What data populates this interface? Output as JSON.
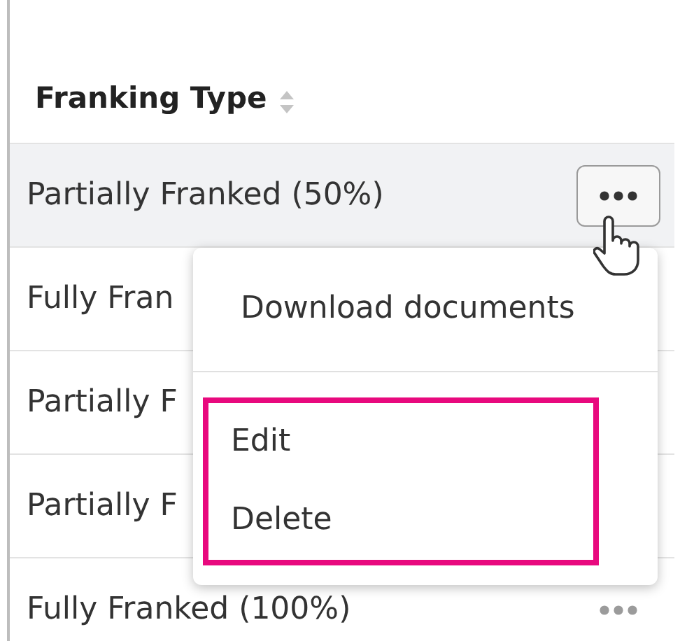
{
  "table": {
    "columns": [
      {
        "label": "Franking Type",
        "sortable": true
      }
    ],
    "rows": [
      {
        "cell": "Partially Franked (50%)",
        "selected": true
      },
      {
        "cell": "Fully Fran",
        "selected": false
      },
      {
        "cell": "Partially F",
        "selected": false
      },
      {
        "cell": "Partially F",
        "selected": false
      },
      {
        "cell": "Fully Franked (100%)",
        "selected": false
      }
    ]
  },
  "menu": {
    "groups": [
      {
        "highlighted": false,
        "items": [
          "Download documents"
        ]
      },
      {
        "highlighted": true,
        "items": [
          "Edit",
          "Delete"
        ]
      }
    ]
  }
}
